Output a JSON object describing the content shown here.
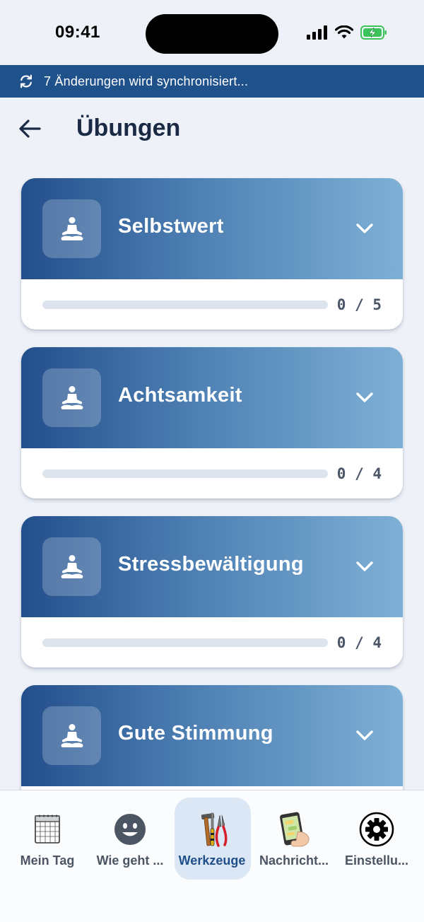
{
  "status_bar": {
    "time": "09:41"
  },
  "sync_banner": {
    "text": "7 Änderungen wird synchronisiert..."
  },
  "header": {
    "title": "Übungen"
  },
  "cards": [
    {
      "title": "Selbstwert",
      "progress": "0 / 5",
      "completed": 0,
      "total": 5
    },
    {
      "title": "Achtsamkeit",
      "progress": "0 / 4",
      "completed": 0,
      "total": 4
    },
    {
      "title": "Stressbewältigung",
      "progress": "0 / 4",
      "completed": 0,
      "total": 4
    },
    {
      "title": "Gute Stimmung"
    }
  ],
  "bottom_nav": {
    "items": [
      {
        "label": "Mein Tag",
        "icon": "calendar-icon"
      },
      {
        "label": "Wie geht ...",
        "icon": "smiley-icon"
      },
      {
        "label": "Werkzeuge",
        "icon": "tools-icon",
        "active": true
      },
      {
        "label": "Nachricht...",
        "icon": "phone-message-icon"
      },
      {
        "label": "Einstellu...",
        "icon": "gear-icon"
      }
    ]
  },
  "colors": {
    "banner": "#1f518b",
    "card_gradient_start": "#234f8c",
    "card_gradient_end": "#7eb0d6",
    "title": "#1b2a44",
    "active_nav_bg": "#dbe7f4"
  }
}
